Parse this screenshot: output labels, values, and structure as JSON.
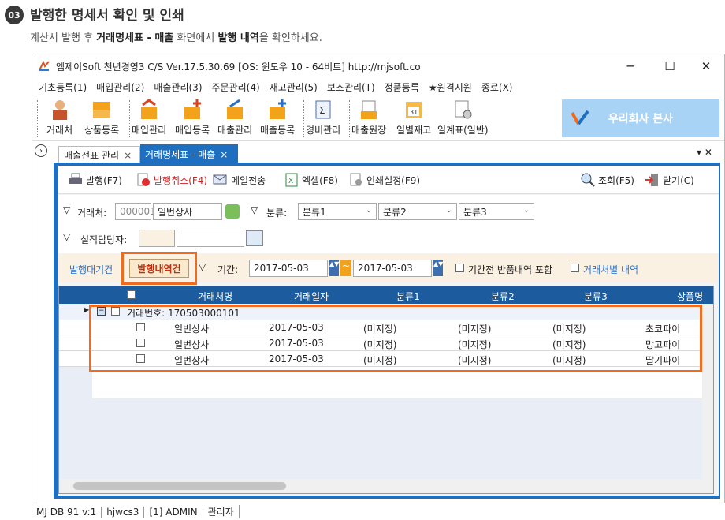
{
  "header": {
    "step": "03",
    "title": "발행한 명세서 확인 및 인쇄",
    "sub_pre": "계산서 발행 후 ",
    "sub_b1": "거래명세표 - 매출",
    "sub_mid": " 화면에서 ",
    "sub_b2": "발행 내역",
    "sub_post": "을 확인하세요."
  },
  "window": {
    "title": "엠제이Soft 천년경영3 C/S   Ver.17.5.30.69   [OS: 윈도우 10 - 64비트]   http://mjsoft.co",
    "min": "─",
    "max": "☐",
    "close": "✕"
  },
  "menu": [
    "기초등록(1)",
    "매입관리(2)",
    "매출관리(3)",
    "주문관리(4)",
    "재고관리(5)",
    "보조관리(T)",
    "정품등록",
    "★원격지원",
    "종료(X)"
  ],
  "toolbar": [
    "거래처",
    "상품등록",
    "매입관리",
    "매입등록",
    "매출관리",
    "매출등록",
    "경비관리",
    "매출원장",
    "일별재고",
    "일계표(일반)"
  ],
  "company": "우리회사 본사",
  "tabs": {
    "t1": "매출전표 관리",
    "t2": "거래명세표 - 매출"
  },
  "subtoolbar": {
    "issue": "발행(F7)",
    "cancel": "발행취소(F4)",
    "mail": "메일전송",
    "excel": "엑셀(F8)",
    "print": "인쇄설정(F9)",
    "search": "조회(F5)",
    "close": "닫기(C)"
  },
  "filter": {
    "client_label": "거래처:",
    "client_code": "000001",
    "client_name": "일번상사",
    "cat_label": "분류:",
    "cat1": "분류1",
    "cat2": "분류2",
    "cat3": "분류3",
    "rep_label": "실적담당자:"
  },
  "row3": {
    "pending": "발행대기건",
    "issued": "발행내역건",
    "period_label": "기간:",
    "from": "2017-05-03",
    "tilde": "~",
    "to": "2017-05-03",
    "chk1": "기간전 반품내역 포함",
    "chk2": "거래처별 내역"
  },
  "grid": {
    "headers": [
      "거래처명",
      "거래일자",
      "분류1",
      "분류2",
      "분류3",
      "상품명"
    ],
    "group": "거래번호: 170503000101",
    "rows": [
      [
        "일번상사",
        "2017-05-03",
        "(미지정)",
        "(미지정)",
        "(미지정)",
        "초코파이"
      ],
      [
        "일번상사",
        "2017-05-03",
        "(미지정)",
        "(미지정)",
        "(미지정)",
        "망고파이"
      ],
      [
        "일번상사",
        "2017-05-03",
        "(미지정)",
        "(미지정)",
        "(미지정)",
        "딸기파이"
      ]
    ]
  },
  "status": [
    "MJ DB 91 v:1",
    "hjwcs3",
    "[1] ADMIN",
    "관리자"
  ],
  "colors": {
    "accent": "#1e6fbf",
    "highlight": "#f06b1d",
    "company_bg": "#a9d3f5"
  }
}
